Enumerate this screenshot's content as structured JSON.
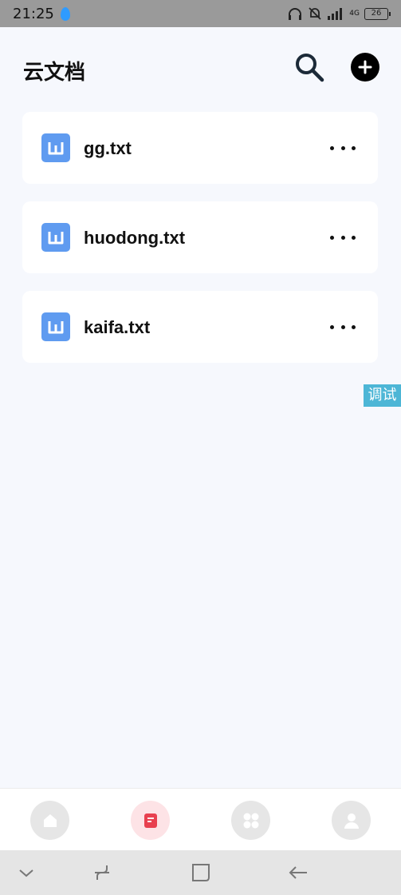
{
  "status_bar": {
    "time": "21:25",
    "network_label": "4G",
    "battery": "26",
    "icons": [
      "headphones-icon",
      "bell-off-icon",
      "signal-icon",
      "battery-icon"
    ]
  },
  "header": {
    "title": "云文档",
    "icons": [
      "search-icon",
      "plus-icon"
    ]
  },
  "files": [
    {
      "name": "gg.txt",
      "icon": "w-doc-icon"
    },
    {
      "name": "huodong.txt",
      "icon": "w-doc-icon"
    },
    {
      "name": "kaifa.txt",
      "icon": "w-doc-icon"
    }
  ],
  "debug_label": "调试",
  "tab_bar": {
    "tabs": [
      {
        "icon": "home-icon",
        "active": false
      },
      {
        "icon": "document-icon",
        "active": true
      },
      {
        "icon": "apps-icon",
        "active": false
      },
      {
        "icon": "user-icon",
        "active": false
      }
    ]
  },
  "colors": {
    "background": "#f6f8fd",
    "card": "#ffffff",
    "doc_icon": "#5f9bf0",
    "active_tab_icon": "#e8404f",
    "active_tab_bg": "#fde3e6",
    "debug_tag": "#4db6d6"
  },
  "system_nav": {
    "icons": [
      "chevron-down-icon",
      "recents-icon",
      "home-square-icon",
      "back-arrow-icon"
    ]
  }
}
